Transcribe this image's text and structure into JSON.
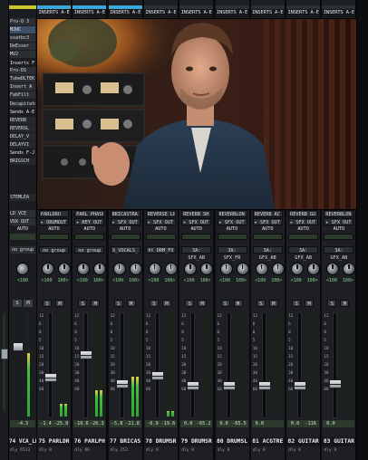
{
  "app": {
    "title": "Pro Tools Mix Window"
  },
  "left_partial": {
    "inserts": [
      "Pro-Q 3",
      "MJUC",
      "ssatbc3",
      "DeEsser",
      "MV2",
      "Inserts F-J",
      "Pro-DS",
      "TubeDLTEK",
      "Insert A",
      "FabFilt"
    ],
    "sends": [
      "Decapitator",
      "Sends A-E",
      "REVERB",
      "REVERSL",
      "DELAY_V",
      "DELAYVI",
      "Sends F-J",
      "BRIGSCH",
      "STEMLEA"
    ],
    "io": [
      "LD VCE",
      "VOX OUT"
    ],
    "auto": "AUTO",
    "group": "no group",
    "pan_value": "<100",
    "solo": "S",
    "mute": "M",
    "vol": "-4.3",
    "name": "74 VCA_LD",
    "dly": "dly 6513"
  },
  "channels": [
    {
      "inserts_title": "INSERTS A-E",
      "io_in": "PARLDRU",
      "io_out": "DRUMOUT",
      "auto": "AUTO",
      "group": "no group",
      "pan_l": "<100",
      "pan_r": "100>",
      "solo": "S",
      "mute": "M",
      "vol_l": "-1.4",
      "vol_r": "-25.8",
      "name": "75 PARLDR",
      "dly": "dly 0",
      "color": "#3aa7d9",
      "fader_level": 0.36,
      "meter_level": 0.12
    },
    {
      "inserts_title": "INSERTS A-E",
      "io_in": "PARL PHASE",
      "io_out": "KEY OUT",
      "auto": "AUTO",
      "group": "no group",
      "pan_l": "<100",
      "pan_r": "100>",
      "solo": "S",
      "mute": "M",
      "vol_l": "-10.6",
      "vol_r": "-26.3",
      "name": "76 PARLPH",
      "dly": "dly 86",
      "color": "#3aa7d9",
      "fader_level": 0.6,
      "meter_level": 0.25
    },
    {
      "inserts_title": "INSERTS A-E",
      "io_in": "BRICASTRA",
      "io_out": "SFX OUT",
      "auto": "AUTO",
      "group": "S_VOCALS_",
      "pan_l": "<100",
      "pan_r": "100>",
      "solo": "S",
      "mute": "M",
      "vol_l": "-5.8",
      "vol_r": "-21.8",
      "name": "77 BRICAS",
      "dly": "dly 252",
      "color": "#3aa7d9",
      "fader_level": 0.3,
      "meter_level": 0.38
    },
    {
      "inserts_title": "INSERTS A-E",
      "io_in": "REVERSE_LP",
      "io_out": "SFX OUT",
      "auto": "AUTO",
      "group": "ht DRM_FX",
      "pan_l": "<100",
      "pan_r": "100>",
      "solo": "S",
      "mute": "M",
      "vol_l": "-0.9",
      "vol_r": "-19.6",
      "name": "78 DRUMSR",
      "dly": "dly 0",
      "color": "#2b3036",
      "fader_level": 0.38,
      "meter_level": 0.05
    },
    {
      "inserts_title": "INSERTS A-E",
      "io_in": "REVERB_SH",
      "io_out": "SFX OUT",
      "auto": "AUTO",
      "group": "3A: SFX_AB",
      "pan_l": "<100",
      "pan_r": "100>",
      "solo": "S",
      "mute": "M",
      "vol_l": "0.0",
      "vol_r": "-65.2",
      "name": "79 DRUMSR",
      "dly": "dly 0",
      "color": "#2b3036",
      "fader_level": 0.28,
      "meter_level": 0.0
    },
    {
      "inserts_title": "INSERTS A-E",
      "io_in": "REVERBLON",
      "io_out": "SFX OUT",
      "auto": "AUTO",
      "group": "3A: SFX_FR",
      "pan_l": "<100",
      "pan_r": "100>",
      "solo": "S",
      "mute": "M",
      "vol_l": "0.0",
      "vol_r": "-65.5",
      "name": "80 DRUMSL",
      "dly": "dly 0",
      "color": "#2b3036",
      "fader_level": 0.28,
      "meter_level": 0.0
    },
    {
      "inserts_title": "INSERTS A-E",
      "io_in": "REVERB_AC",
      "io_out": "SFX OUT",
      "auto": "AUTO",
      "group": "3A: GFX_AB",
      "pan_l": "<100",
      "pan_r": "100>",
      "solo": "S",
      "mute": "M",
      "vol_l": "0.0",
      "vol_r": "",
      "name": "81 ACGTRE",
      "dly": "dly 0",
      "color": "#2b3036",
      "fader_level": 0.28,
      "meter_level": 0.0
    },
    {
      "inserts_title": "INSERTS A-E",
      "io_in": "REVERB_GU",
      "io_out": "SFX OUT",
      "auto": "AUTO",
      "group": "3A: GFX_AB",
      "pan_l": "<100",
      "pan_r": "100>",
      "solo": "S",
      "mute": "M",
      "vol_l": "0.0",
      "vol_r": "-116",
      "name": "82 GUITAR",
      "dly": "dly 0",
      "color": "#2b3036",
      "fader_level": 0.28,
      "meter_level": 0.0
    },
    {
      "inserts_title": "INSERTS A-E",
      "io_in": "REVERBLON",
      "io_out": "SFX OUT",
      "auto": "AUTO",
      "group": "3A: GFX_AB",
      "pan_l": "<100",
      "pan_r": "100>",
      "solo": "S",
      "mute": "M",
      "vol_l": "0.0",
      "vol_r": "",
      "name": "83 GUITAR",
      "dly": "dly 0",
      "color": "#2b3036",
      "fader_level": 0.3,
      "meter_level": 0.0
    }
  ],
  "fader_scale": [
    "12",
    "6",
    "0",
    "5",
    "10",
    "15",
    "20",
    "30",
    "40",
    "60"
  ],
  "video": {
    "description_icon": "presenter-video-overlay"
  }
}
